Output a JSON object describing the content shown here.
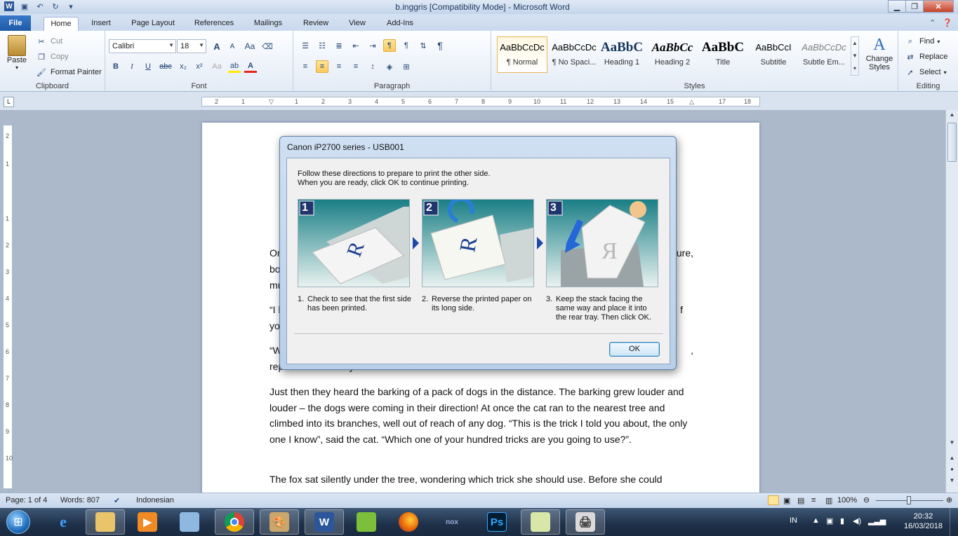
{
  "window": {
    "title": "b.inggris [Compatibility Mode]  -  Microsoft Word"
  },
  "tabs": [
    "File",
    "Home",
    "Insert",
    "Page Layout",
    "References",
    "Mailings",
    "Review",
    "View",
    "Add-Ins"
  ],
  "clipboard": {
    "paste": "Paste",
    "cut": "Cut",
    "copy": "Copy",
    "format_painter": "Format Painter",
    "label": "Clipboard"
  },
  "font": {
    "name": "Calibri",
    "size": "18",
    "label": "Font",
    "bold": "B",
    "italic": "I",
    "underline": "U",
    "strike": "abc",
    "sub": "x₂",
    "sup": "x²",
    "clear": "Aa",
    "grow": "A",
    "shrink": "A",
    "case": "Aa"
  },
  "paragraph": {
    "label": "Paragraph"
  },
  "styles": {
    "label": "Styles",
    "change_styles": "Change Styles",
    "items": [
      {
        "sample": "AaBbCcDc",
        "name": "¶ Normal"
      },
      {
        "sample": "AaBbCcDc",
        "name": "¶ No Spaci..."
      },
      {
        "sample": "AaBbC",
        "name": "Heading 1"
      },
      {
        "sample": "AaBbCc",
        "name": "Heading 2"
      },
      {
        "sample": "AaBbC",
        "name": "Title"
      },
      {
        "sample": "AaBbCcI",
        "name": "Subtitle"
      },
      {
        "sample": "AaBbCcDc",
        "name": "Subtle Em..."
      }
    ]
  },
  "editing": {
    "find": "Find",
    "replace": "Replace",
    "select": "Select",
    "label": "Editing"
  },
  "document": {
    "fragments": {
      "l1a": "On",
      "l1b": "ure,",
      "l2a": "bo",
      "l3a": "mu",
      "l4a": "“I l",
      "l4b": "f",
      "l5a": "yo",
      "l6a": "“W",
      "l6b": ",",
      "l7a": "replied the fox airily."
    },
    "para1": "Just then they heard the barking of a pack of dogs in the distance. The barking grew louder and louder – the dogs were coming in their direction! At once the cat ran to the nearest tree and climbed into its branches, well out of reach of any dog. “This is the trick I told you about, the only one I know”, said the cat. “Which one of your hundred tricks are you going to use?”.",
    "para2": "The fox sat silently under the tree, wondering which trick she should use. Before she could"
  },
  "dialog": {
    "title": "Canon iP2700 series - USB001",
    "line1": "Follow these directions to prepare to print the other side.",
    "line2": "When you are ready, click OK to continue printing.",
    "steps": [
      {
        "num": "1.",
        "badge": "1",
        "text": "Check to see that the first side has been printed."
      },
      {
        "num": "2.",
        "badge": "2",
        "text": "Reverse the printed paper on its long side."
      },
      {
        "num": "3.",
        "badge": "3",
        "text": "Keep the stack facing the same way and place it into the rear tray. Then click OK."
      }
    ],
    "ok": "OK"
  },
  "status": {
    "page": "Page: 1 of 4",
    "words": "Words: 807",
    "language": "Indonesian",
    "zoom": "100%"
  },
  "tray": {
    "lang": "IN",
    "time": "20:32",
    "date": "16/03/2018"
  },
  "colors": {
    "accent": "#1d5aa8",
    "dialog_teal": "#1a7f86"
  }
}
